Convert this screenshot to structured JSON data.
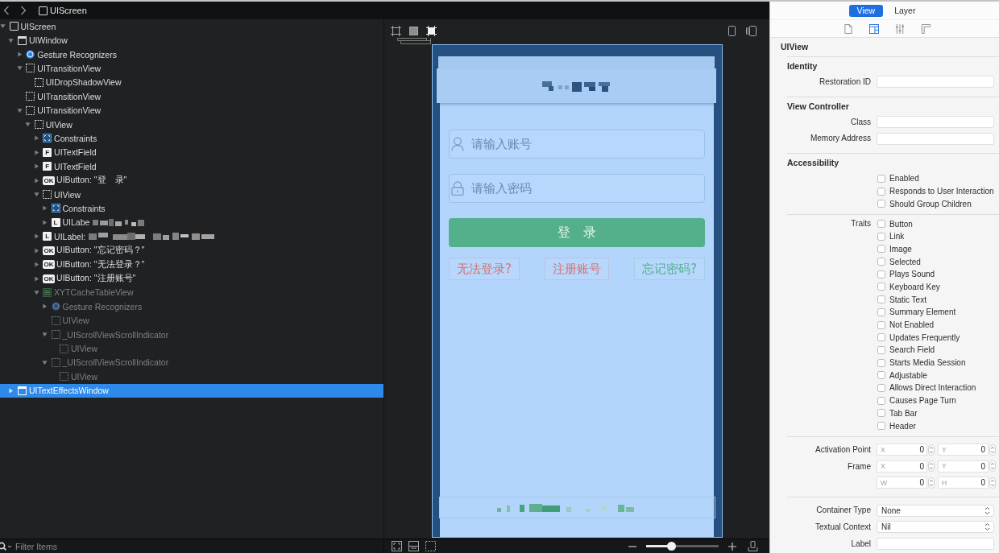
{
  "jump_bar": {
    "items": [
      {
        "kind": "screen",
        "label": "UIScreen"
      }
    ]
  },
  "hierarchy": {
    "items": [
      {
        "label": "UIScreen",
        "kind": "screen",
        "expanded": true,
        "selected": false,
        "dimmed": false,
        "children": [
          {
            "label": "UIWindow",
            "kind": "window",
            "expanded": true,
            "selected": false,
            "dimmed": false,
            "children": [
              {
                "label": "Gesture Recognizers",
                "kind": "gesture",
                "expanded": false,
                "selected": false,
                "dimmed": false
              },
              {
                "label": "UITransitionView",
                "kind": "view",
                "expanded": true,
                "selected": false,
                "dimmed": false,
                "children": [
                  {
                    "label": "UIDropShadowView",
                    "kind": "view",
                    "selected": false,
                    "dimmed": false
                  }
                ]
              },
              {
                "label": "UITransitionView",
                "kind": "view",
                "selected": false,
                "dimmed": false
              },
              {
                "label": "UITransitionView",
                "kind": "view",
                "expanded": true,
                "selected": false,
                "dimmed": false,
                "children": [
                  {
                    "label": "UIView",
                    "kind": "view",
                    "expanded": true,
                    "selected": false,
                    "dimmed": false,
                    "children": [
                      {
                        "label": "Constraints",
                        "kind": "constraints",
                        "expanded": false,
                        "selected": false,
                        "dimmed": false
                      },
                      {
                        "label": "UITextField",
                        "kind": "textfield",
                        "badge": "F",
                        "expanded": false,
                        "selected": false,
                        "dimmed": false
                      },
                      {
                        "label": "UITextField",
                        "kind": "textfield",
                        "badge": "F",
                        "expanded": false,
                        "selected": false,
                        "dimmed": false
                      },
                      {
                        "label": "UIButton: \"登　录\"",
                        "kind": "button",
                        "badge": "OK",
                        "expanded": false,
                        "selected": false,
                        "dimmed": false
                      },
                      {
                        "label": "UIView",
                        "kind": "view",
                        "expanded": true,
                        "selected": false,
                        "dimmed": false,
                        "children": [
                          {
                            "label": "Constraints",
                            "kind": "constraints",
                            "expanded": false,
                            "selected": false,
                            "dimmed": false
                          },
                          {
                            "label": "UILabe",
                            "kind": "label",
                            "badge": "L",
                            "redaction": {
                              "kind": "short"
                            },
                            "expanded": false,
                            "selected": false,
                            "dimmed": false
                          }
                        ]
                      },
                      {
                        "label": "UILabel:",
                        "kind": "label",
                        "badge": "L",
                        "redaction": {
                          "kind": "long"
                        },
                        "expanded": false,
                        "selected": false,
                        "dimmed": false
                      },
                      {
                        "label": "UIButton: \"忘记密码？\"",
                        "kind": "button",
                        "badge": "OK",
                        "expanded": false,
                        "selected": false,
                        "dimmed": false
                      },
                      {
                        "label": "UIButton: \"无法登录？\"",
                        "kind": "button",
                        "badge": "OK",
                        "expanded": false,
                        "selected": false,
                        "dimmed": false
                      },
                      {
                        "label": "UIButton: \"注册账号\"",
                        "kind": "button",
                        "badge": "OK",
                        "expanded": false,
                        "selected": false,
                        "dimmed": false
                      },
                      {
                        "label": "XYTCacheTableView",
                        "kind": "table",
                        "expanded": true,
                        "selected": false,
                        "dimmed": true,
                        "children": [
                          {
                            "label": "Gesture Recognizers",
                            "kind": "gesture",
                            "expanded": false,
                            "selected": false,
                            "dimmed": true
                          },
                          {
                            "label": "UIView",
                            "kind": "view",
                            "selected": false,
                            "dimmed": true
                          },
                          {
                            "label": "_UIScrollViewScrollIndicator",
                            "kind": "view",
                            "expanded": true,
                            "selected": false,
                            "dimmed": true,
                            "children": [
                              {
                                "label": "UIView",
                                "kind": "view",
                                "selected": false,
                                "dimmed": true
                              }
                            ]
                          },
                          {
                            "label": "_UIScrollViewScrollIndicator",
                            "kind": "view",
                            "expanded": true,
                            "selected": false,
                            "dimmed": true,
                            "children": [
                              {
                                "label": "UIView",
                                "kind": "view",
                                "selected": false,
                                "dimmed": true
                              }
                            ]
                          }
                        ]
                      }
                    ]
                  }
                ]
              }
            ]
          },
          {
            "label": "UITextEffectsWindow",
            "kind": "window",
            "expanded": false,
            "selected": true,
            "dimmed": false
          }
        ]
      }
    ]
  },
  "filter": {
    "placeholder": "Filter Items"
  },
  "canvas": {
    "view_modes": [
      {
        "kind": "wireframe",
        "selected": false
      },
      {
        "kind": "contents",
        "selected": false
      },
      {
        "kind": "combined",
        "selected": true
      }
    ],
    "app": {
      "nav_bar": {
        "title_redacted": true
      },
      "fields": [
        {
          "kind": "user",
          "placeholder": "请输入账号"
        },
        {
          "kind": "lock",
          "placeholder": "请输入密码"
        }
      ],
      "login_button": {
        "label": "登　录"
      },
      "links": [
        {
          "label": "无法登录?",
          "color": "#d9706c"
        },
        {
          "label": "注册账号",
          "color": "#d9706c"
        },
        {
          "label": "忘记密码?",
          "color": "#55b08c"
        }
      ],
      "footer": {
        "redacted": true
      }
    }
  },
  "canvas_bar": {
    "zoom": {
      "level": 0.33
    }
  },
  "inspector": {
    "tabs": [
      {
        "label": "View",
        "selected": true
      },
      {
        "label": "Layer",
        "selected": false
      }
    ],
    "panes": [
      {
        "kind": "file",
        "selected": false
      },
      {
        "kind": "layout",
        "selected": true
      },
      {
        "kind": "sliders",
        "selected": false
      },
      {
        "kind": "ruler",
        "selected": false
      }
    ],
    "title": "UIView",
    "sections": [
      {
        "title": "Identity",
        "rows": [
          {
            "kind": "text",
            "label": "Restoration ID"
          }
        ]
      },
      {
        "title": "View Controller",
        "rows": [
          {
            "kind": "text",
            "label": "Class"
          },
          {
            "kind": "text",
            "label": "Memory Address"
          }
        ]
      },
      {
        "title": "Accessibility",
        "rows": [
          {
            "kind": "checks",
            "items": [
              {
                "label": "Enabled",
                "checked": false
              },
              {
                "label": "Responds to User Interaction",
                "checked": false
              },
              {
                "label": "Should Group Children",
                "checked": false
              }
            ]
          }
        ]
      },
      {
        "rows": [
          {
            "kind": "checks",
            "label": "Traits",
            "items": [
              {
                "label": "Button",
                "checked": false
              },
              {
                "label": "Link",
                "checked": false
              },
              {
                "label": "Image",
                "checked": false
              },
              {
                "label": "Selected",
                "checked": false
              },
              {
                "label": "Plays Sound",
                "checked": false
              },
              {
                "label": "Keyboard Key",
                "checked": false
              },
              {
                "label": "Static Text",
                "checked": false
              },
              {
                "label": "Summary Element",
                "checked": false
              },
              {
                "label": "Not Enabled",
                "checked": false
              },
              {
                "label": "Updates Frequently",
                "checked": false
              },
              {
                "label": "Search Field",
                "checked": false
              },
              {
                "label": "Starts Media Session",
                "checked": false
              },
              {
                "label": "Adjustable",
                "checked": false
              },
              {
                "label": "Allows Direct Interaction",
                "checked": false
              },
              {
                "label": "Causes Page Turn",
                "checked": false
              },
              {
                "label": "Tab Bar",
                "checked": false
              },
              {
                "label": "Header",
                "checked": false
              }
            ]
          }
        ]
      },
      {
        "rows": [
          {
            "kind": "numbers",
            "label": "Activation Point",
            "fields": [
              {
                "axis": "X",
                "value": "0"
              },
              {
                "axis": "Y",
                "value": "0"
              }
            ]
          },
          {
            "kind": "numbers",
            "label": "Frame",
            "fields": [
              {
                "axis": "X",
                "value": "0"
              },
              {
                "axis": "Y",
                "value": "0"
              }
            ]
          },
          {
            "kind": "numbers",
            "fields": [
              {
                "axis": "W",
                "value": "0"
              },
              {
                "axis": "H",
                "value": "0"
              }
            ]
          }
        ]
      },
      {
        "rows": [
          {
            "kind": "popup",
            "label": "Container Type",
            "value": "None"
          },
          {
            "kind": "popup",
            "label": "Textual Context",
            "value": "Nil"
          },
          {
            "kind": "text",
            "label": "Label"
          }
        ]
      }
    ]
  }
}
